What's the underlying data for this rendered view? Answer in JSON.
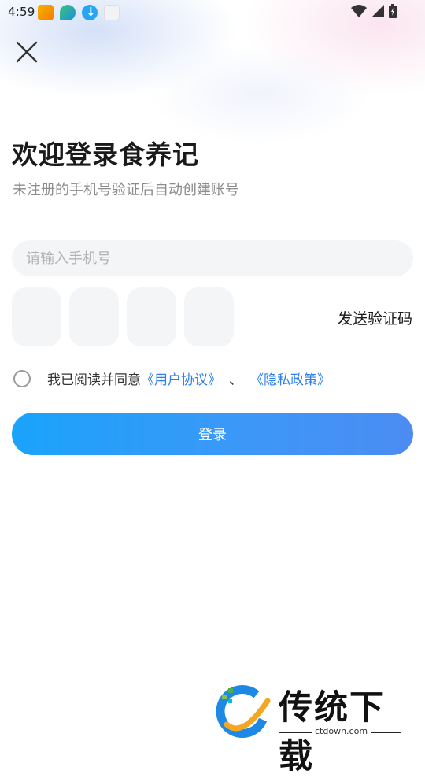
{
  "status_bar": {
    "time": "4:59",
    "apps": [
      "app-icon-1",
      "app-icon-2",
      "download-icon",
      "app-icon-4"
    ],
    "right_icons": [
      "wifi-icon",
      "signal-icon",
      "battery-icon"
    ]
  },
  "header": {
    "close_icon": "close-icon",
    "title": "欢迎登录食养记",
    "subtitle": "未注册的手机号验证后自动创建账号"
  },
  "form": {
    "phone_placeholder": "请输入手机号",
    "phone_value": "",
    "code_boxes": [
      "",
      "",
      "",
      ""
    ],
    "send_code_label": "发送验证码"
  },
  "agreement": {
    "prefix": "我已阅读并同意",
    "user_agreement": "《用户协议》",
    "separator": "、",
    "privacy_policy": "《隐私政策》",
    "checked": false
  },
  "login_label": "登录",
  "watermark": {
    "text": "传统下载",
    "url": "ctdown.com"
  },
  "colors": {
    "accent": "#2d7ff0",
    "button_start": "#1aa3fb",
    "button_end": "#4c8cf3"
  }
}
